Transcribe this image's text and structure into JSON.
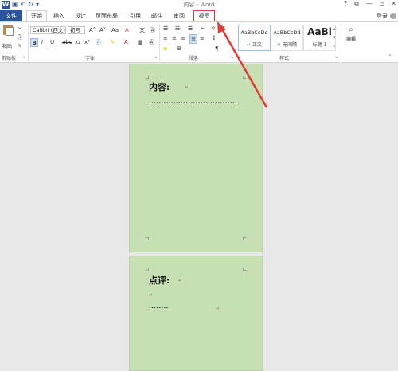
{
  "titlebar": {
    "title": "内容 - Word",
    "logo": "W",
    "controls": [
      "?",
      "⧉",
      "—",
      "▫",
      "✕"
    ]
  },
  "tabs": {
    "file": "文件",
    "items": [
      "开始",
      "插入",
      "设计",
      "页面布局",
      "引用",
      "邮件",
      "审阅",
      "视图"
    ],
    "login": "登录"
  },
  "ribbon": {
    "clipboard": {
      "paste": "粘贴",
      "label": "剪贴板"
    },
    "font": {
      "label": "字体",
      "font_name": "Calibri (西文)",
      "font_size": "初号",
      "bold": "B",
      "italic": "I",
      "underline": "U",
      "strike": "abc",
      "sub": "x₂",
      "sup": "x²",
      "grow": "A˄",
      "shrink": "A˅",
      "case": "Aa",
      "clear": "A"
    },
    "paragraph": {
      "label": "段落"
    },
    "styles": {
      "label": "样式",
      "items": [
        {
          "preview": "AaBbCcDd",
          "name": "↵ 正文"
        },
        {
          "preview": "AaBbCcDd",
          "name": "↵ 无间隔"
        },
        {
          "preview": "AaBl",
          "name": "标题 1"
        }
      ]
    },
    "editing": {
      "label": "编辑"
    }
  },
  "document": {
    "page1": {
      "heading": "内容:",
      "dots": "······································"
    },
    "page2": {
      "heading": "点评:",
      "dots": "········"
    }
  },
  "colors": {
    "accent": "#2b579a",
    "page_bg": "#c6e0b4",
    "highlight": "#e53935"
  }
}
